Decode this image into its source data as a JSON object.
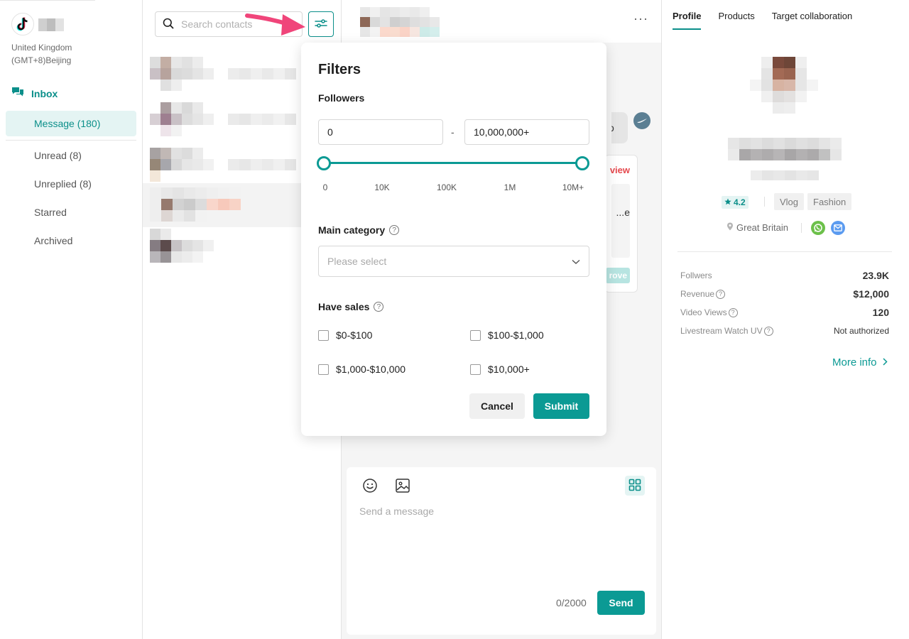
{
  "sidebar": {
    "region": "United Kingdom",
    "timezone": "(GMT+8)Beijing",
    "inbox_label": "Inbox",
    "items": [
      {
        "label": "Message (180)",
        "active": true
      },
      {
        "label": "Unread (8)"
      },
      {
        "label": "Unreplied  (8)"
      },
      {
        "label": "Starred"
      },
      {
        "label": "Archived"
      }
    ]
  },
  "contacts": {
    "search_placeholder": "Search contacts"
  },
  "chat": {
    "more": "···",
    "bubble_text": "ello",
    "card_review": "view",
    "card_snippet": "e...",
    "card_approve": "rove",
    "composer": {
      "placeholder": "Send a message",
      "counter": "0/2000",
      "send_label": "Send"
    }
  },
  "filters": {
    "title": "Filters",
    "followers_label": "Followers",
    "min_value": "0",
    "max_value": "10,000,000+",
    "range_separator": "-",
    "slider_ticks": [
      "0",
      "10K",
      "100K",
      "1M",
      "10M+"
    ],
    "slider_range": {
      "low_fraction": 0.0,
      "high_fraction": 1.0
    },
    "main_category_label": "Main category",
    "main_category_placeholder": "Please select",
    "have_sales_label": "Have sales",
    "sales_options": [
      "$0-$100",
      "$100-$1,000",
      "$1,000-$10,000",
      "$10,000+"
    ],
    "cancel_label": "Cancel",
    "submit_label": "Submit"
  },
  "profile": {
    "tabs": [
      "Profile",
      "Products",
      "Target collaboration"
    ],
    "rating": "4.2",
    "tags": [
      "Vlog",
      "Fashion"
    ],
    "location": "Great Britain",
    "stats": [
      {
        "label": "Follwers",
        "value": "23.9K",
        "help": false
      },
      {
        "label": "Revenue",
        "value": "$12,000",
        "help": true
      },
      {
        "label": "Video Views",
        "value": "120",
        "help": true
      },
      {
        "label": "Livestream Watch UV",
        "value": "Not authorized",
        "help": true
      }
    ],
    "more_info": "More info"
  },
  "colors": {
    "accent": "#0b9a94",
    "annotation_arrow": "#f0457a",
    "review_red": "#e5484d"
  }
}
